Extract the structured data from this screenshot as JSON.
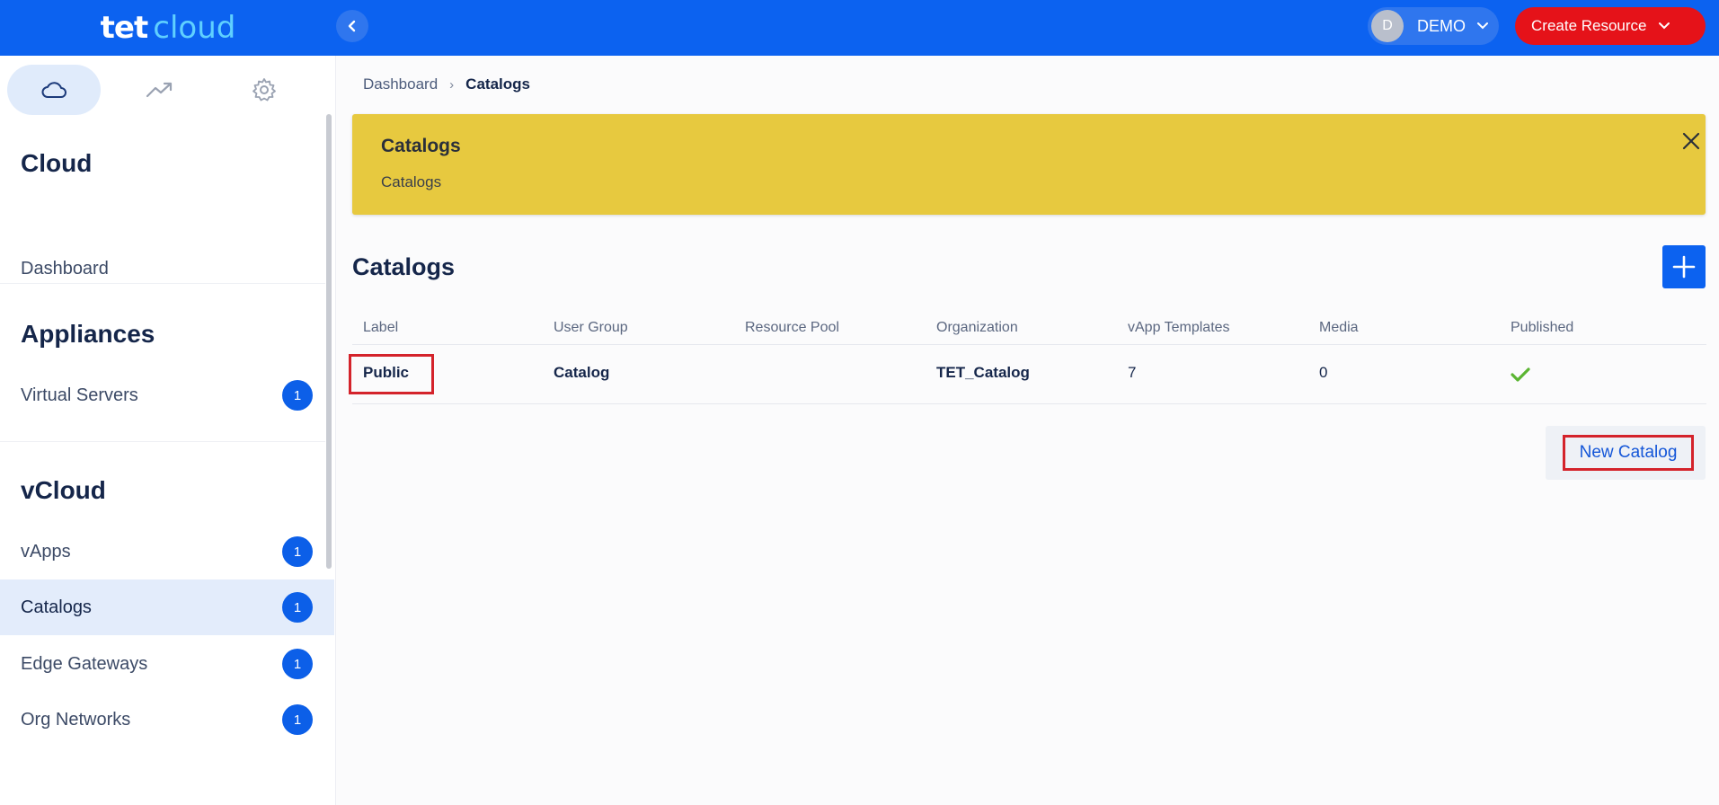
{
  "brand": {
    "part1": "tet",
    "part2": "cloud"
  },
  "header": {
    "user_initial": "D",
    "user_name": "DEMO",
    "create_label": "Create Resource"
  },
  "sidebar": {
    "tabs": [
      {
        "icon": "cloud-icon",
        "active": true
      },
      {
        "icon": "trending-up-icon",
        "active": false
      },
      {
        "icon": "gear-icon",
        "active": false
      }
    ],
    "sections": [
      {
        "title": "Cloud",
        "items": [
          {
            "label": "Dashboard",
            "badge": ""
          }
        ]
      },
      {
        "title": "Appliances",
        "items": [
          {
            "label": "Virtual Servers",
            "badge": "1"
          }
        ]
      },
      {
        "title": "vCloud",
        "items": [
          {
            "label": "vApps",
            "badge": "1"
          },
          {
            "label": "Catalogs",
            "badge": "1",
            "active": true
          },
          {
            "label": "Edge Gateways",
            "badge": "1"
          },
          {
            "label": "Org Networks",
            "badge": "1"
          }
        ]
      }
    ]
  },
  "breadcrumb": {
    "parent": "Dashboard",
    "separator": "›",
    "current": "Catalogs"
  },
  "alert": {
    "title": "Catalogs",
    "body": "Catalogs"
  },
  "main": {
    "title": "Catalogs",
    "table": {
      "headers": [
        "Label",
        "User Group",
        "Resource Pool",
        "Organization",
        "vApp Templates",
        "Media",
        "Published"
      ],
      "rows": [
        {
          "label": "Public",
          "user_group": "Catalog",
          "resource_pool": "",
          "organization": "TET_Catalog",
          "vapp_templates": "7",
          "media": "0",
          "published": true
        }
      ]
    },
    "new_catalog_label": "New Catalog"
  },
  "colors": {
    "header_bg": "#0c62f0",
    "create_btn": "#e51219",
    "alert_bg": "#e7c93f",
    "badge": "#0c5fe8",
    "highlight": "#d4232b",
    "published_check": "#5bb532"
  }
}
